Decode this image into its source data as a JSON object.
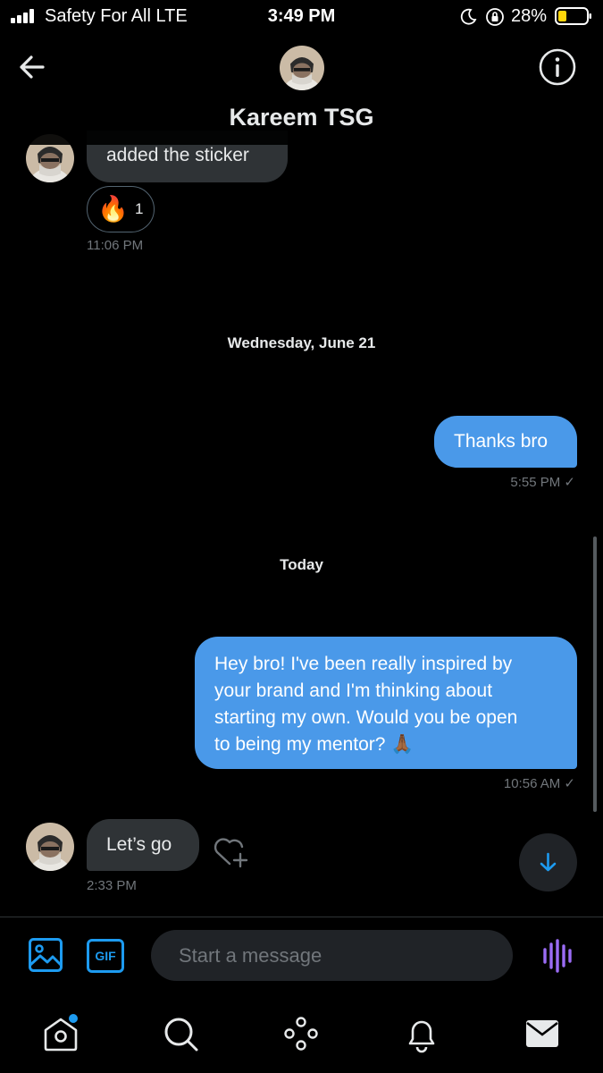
{
  "status_bar": {
    "carrier": "Safety For All  LTE",
    "time": "3:49 PM",
    "battery": "28%"
  },
  "header": {
    "title": "Kareem TSG",
    "back_icon": "back-arrow-icon",
    "info_icon": "info-icon"
  },
  "messages": [
    {
      "direction": "incoming",
      "text": "added the sticker",
      "reaction": {
        "emoji": "🔥",
        "count": "1"
      },
      "time": "11:06 PM"
    },
    {
      "day_separator": "Wednesday, June 21"
    },
    {
      "direction": "outgoing",
      "text": "Thanks bro",
      "time": "5:55 PM ✓"
    },
    {
      "day_separator": "Today"
    },
    {
      "direction": "outgoing",
      "lines": [
        "Hey bro! I've been really inspired by",
        "your brand and I'm thinking about",
        "starting my own. Would you be open",
        "to being my mentor? 🙏🏾"
      ],
      "time": "10:56 AM ✓"
    },
    {
      "direction": "incoming",
      "text": "Let’s go",
      "time": "2:33 PM"
    }
  ],
  "composer": {
    "gif_label": "GIF",
    "placeholder": "Start a message"
  },
  "bottom_nav": [
    "home-icon",
    "search-icon",
    "spaces-icon",
    "notifications-icon",
    "messages-icon"
  ],
  "colors": {
    "accent": "#1d9bf0",
    "outgoing_bubble": "#4a99e9",
    "incoming_bubble": "#2f3336",
    "voice": "#9b6cf6",
    "background": "#000000"
  }
}
